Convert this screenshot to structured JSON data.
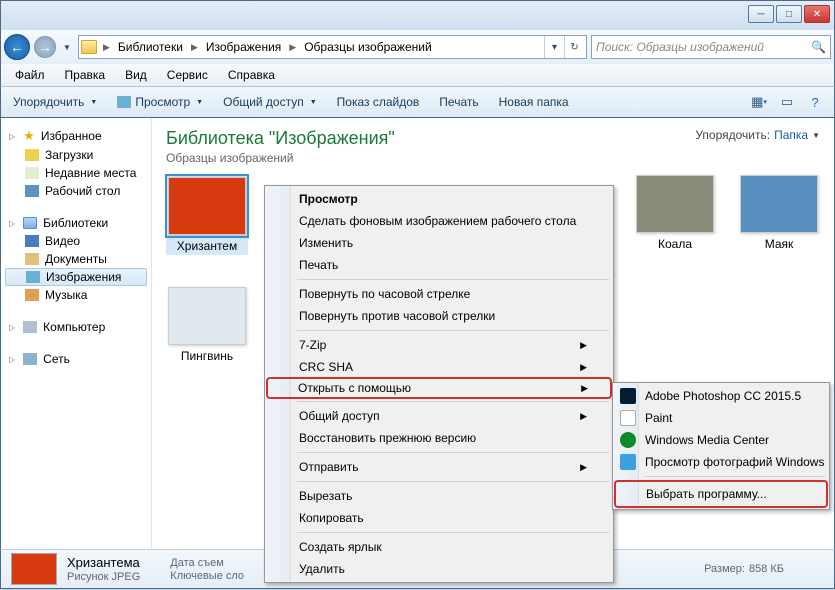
{
  "breadcrumb": {
    "items": [
      "Библиотеки",
      "Изображения",
      "Образцы изображений"
    ]
  },
  "search": {
    "placeholder": "Поиск: Образцы изображений"
  },
  "menu": {
    "items": [
      "Файл",
      "Правка",
      "Вид",
      "Сервис",
      "Справка"
    ]
  },
  "toolbar": {
    "organize": "Упорядочить",
    "view": "Просмотр",
    "share": "Общий доступ",
    "slideshow": "Показ слайдов",
    "print": "Печать",
    "newfolder": "Новая папка"
  },
  "sidebar": {
    "favorites": {
      "label": "Избранное",
      "items": [
        "Загрузки",
        "Недавние места",
        "Рабочий стол"
      ]
    },
    "libraries": {
      "label": "Библиотеки",
      "items": [
        "Видео",
        "Документы",
        "Изображения",
        "Музыка"
      ],
      "selected_index": 2
    },
    "computer": {
      "label": "Компьютер"
    },
    "network": {
      "label": "Сеть"
    }
  },
  "library": {
    "title": "Библиотека \"Изображения\"",
    "subtitle": "Образцы изображений",
    "sort_label": "Упорядочить:",
    "sort_value": "Папка"
  },
  "thumbs": [
    {
      "label": "Хризантем",
      "color": "#d83a10",
      "selected": true
    },
    {
      "label": "Коала",
      "color": "#8a8a7a"
    },
    {
      "label": "Маяк",
      "color": "#5a90c0"
    },
    {
      "label": "Пингвинь",
      "color": "#e0e8f0"
    }
  ],
  "details": {
    "name": "Хризантема",
    "type": "Рисунок JPEG",
    "date_label": "Дата съем",
    "keywords_label": "Ключевые сло",
    "size_label": "Размер:",
    "size_value": "858 КБ"
  },
  "context_main": {
    "items": [
      {
        "label": "Просмотр",
        "bold": true
      },
      {
        "label": "Сделать фоновым изображением рабочего стола"
      },
      {
        "label": "Изменить"
      },
      {
        "label": "Печать"
      },
      {
        "sep": true
      },
      {
        "label": "Повернуть по часовой стрелке"
      },
      {
        "label": "Повернуть против часовой стрелки"
      },
      {
        "sep": true
      },
      {
        "label": "7-Zip",
        "arrow": true
      },
      {
        "label": "CRC SHA",
        "arrow": true
      },
      {
        "label": "Открыть с помощью",
        "arrow": true,
        "highlight": true
      },
      {
        "sep": true
      },
      {
        "label": "Общий доступ",
        "arrow": true
      },
      {
        "label": "Восстановить прежнюю версию"
      },
      {
        "sep": true
      },
      {
        "label": "Отправить",
        "arrow": true
      },
      {
        "sep": true
      },
      {
        "label": "Вырезать"
      },
      {
        "label": "Копировать"
      },
      {
        "sep": true
      },
      {
        "label": "Создать ярлык"
      },
      {
        "label": "Удалить"
      }
    ]
  },
  "context_sub": {
    "items": [
      {
        "label": "Adobe Photoshop CC 2015.5",
        "icon": "ps"
      },
      {
        "label": "Paint",
        "icon": "paint"
      },
      {
        "label": "Windows Media Center",
        "icon": "wmc"
      },
      {
        "label": "Просмотр фотографий Windows",
        "icon": "photo"
      }
    ],
    "choose": "Выбрать программу..."
  }
}
